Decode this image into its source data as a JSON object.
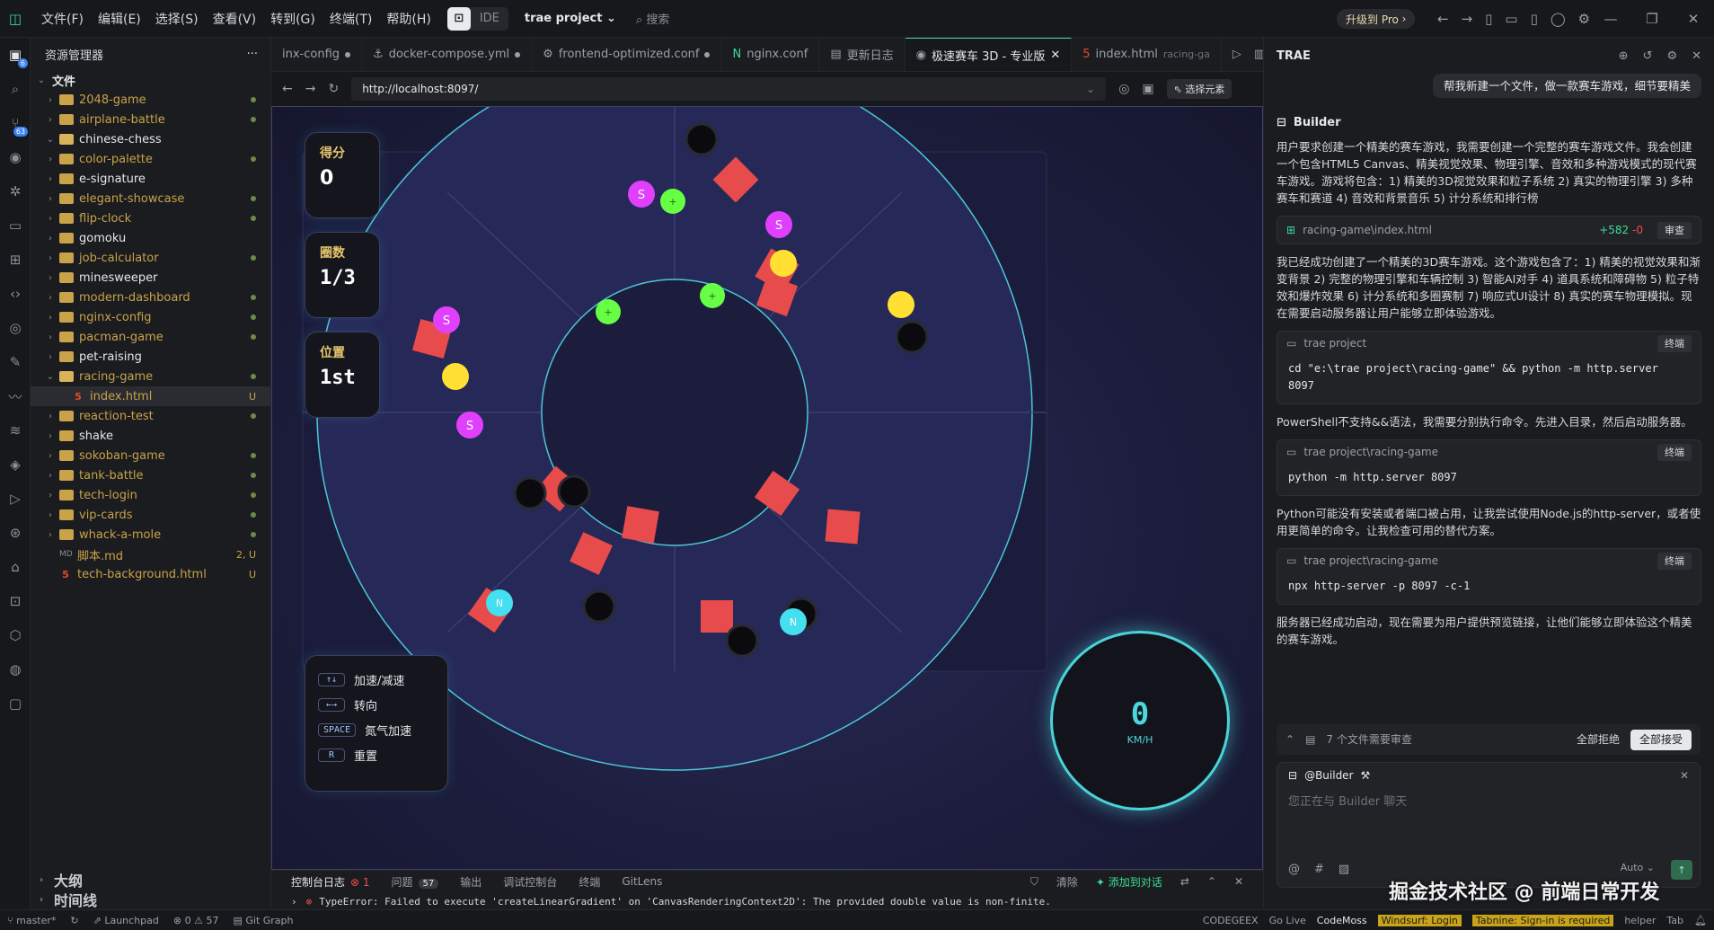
{
  "titlebar": {
    "menu": [
      "文件(F)",
      "编辑(E)",
      "选择(S)",
      "查看(V)",
      "转到(G)",
      "终端(T)",
      "帮助(H)"
    ],
    "ide_label": "IDE",
    "project": "trae project",
    "search": "搜索",
    "upgrade": "升级到 Pro"
  },
  "explorer": {
    "title": "资源管理器",
    "root": "文件",
    "items": [
      {
        "name": "2048-game",
        "type": "folder"
      },
      {
        "name": "airplane-battle",
        "type": "folder"
      },
      {
        "name": "chinese-chess",
        "type": "folder-open"
      },
      {
        "name": "color-palette",
        "type": "folder"
      },
      {
        "name": "e-signature",
        "type": "folder"
      },
      {
        "name": "elegant-showcase",
        "type": "folder"
      },
      {
        "name": "flip-clock",
        "type": "folder"
      },
      {
        "name": "gomoku",
        "type": "folder"
      },
      {
        "name": "job-calculator",
        "type": "folder"
      },
      {
        "name": "minesweeper",
        "type": "folder"
      },
      {
        "name": "modern-dashboard",
        "type": "folder"
      },
      {
        "name": "nginx-config",
        "type": "folder"
      },
      {
        "name": "pacman-game",
        "type": "folder"
      },
      {
        "name": "pet-raising",
        "type": "folder"
      },
      {
        "name": "racing-game",
        "type": "folder-open"
      },
      {
        "name": "index.html",
        "type": "html",
        "status": "U"
      },
      {
        "name": "reaction-test",
        "type": "folder"
      },
      {
        "name": "shake",
        "type": "folder"
      },
      {
        "name": "sokoban-game",
        "type": "folder"
      },
      {
        "name": "tank-battle",
        "type": "folder"
      },
      {
        "name": "tech-login",
        "type": "folder"
      },
      {
        "name": "vip-cards",
        "type": "folder"
      },
      {
        "name": "whack-a-mole",
        "type": "folder"
      },
      {
        "name": "脚本.md",
        "type": "md",
        "status": "2, U"
      },
      {
        "name": "tech-background.html",
        "type": "html",
        "status": "U"
      }
    ],
    "outline": "大纲",
    "timeline": "时间线"
  },
  "editor": {
    "tabs": [
      {
        "label": "inx-config",
        "icon": "",
        "active": false,
        "modified": true
      },
      {
        "label": "docker-compose.yml",
        "icon": "⚓",
        "active": false,
        "modified": true
      },
      {
        "label": "frontend-optimized.conf",
        "icon": "⚙",
        "active": false,
        "modified": true
      },
      {
        "label": "nginx.conf",
        "icon": "N",
        "active": false,
        "modified": false
      },
      {
        "label": "更新日志",
        "icon": "▤",
        "active": false,
        "modified": false
      },
      {
        "label": "极速赛车 3D - 专业版",
        "icon": "◉",
        "active": true,
        "modified": false
      },
      {
        "label": "index.html",
        "icon": "5",
        "active": false,
        "modified": false,
        "suffix": "racing-ga"
      }
    ],
    "url": "http://localhost:8097/",
    "pick_element": "选择元素"
  },
  "game": {
    "score_label": "得分",
    "score": "0",
    "lap_label": "圈数",
    "lap": "1/3",
    "pos_label": "位置",
    "pos": "1st",
    "controls": [
      {
        "key": "↑↓",
        "label": "加速/减速"
      },
      {
        "key": "←→",
        "label": "转向"
      },
      {
        "key": "SPACE",
        "label": "氮气加速"
      },
      {
        "key": "R",
        "label": "重置"
      }
    ],
    "speed": "0",
    "speed_unit": "KM/H"
  },
  "bottom": {
    "tabs": [
      {
        "label": "控制台日志",
        "err": "1"
      },
      {
        "label": "问题",
        "count": "57"
      },
      {
        "label": "输出"
      },
      {
        "label": "调试控制台"
      },
      {
        "label": "终端"
      },
      {
        "label": "GitLens"
      }
    ],
    "clear": "清除",
    "add_to_chat": "添加到对话",
    "error": "TypeError: Failed to execute 'createLinearGradient' on 'CanvasRenderingContext2D': The provided double value is non-finite."
  },
  "chat": {
    "title": "TRAE",
    "user_msg": "帮我新建一个文件，做一款赛车游戏，细节要精美",
    "builder": "Builder",
    "p1": "用户要求创建一个精美的赛车游戏，我需要创建一个完整的赛车游戏文件。我会创建一个包含HTML5 Canvas、精美视觉效果、物理引擎、音效和多种游戏模式的现代赛车游戏。游戏将包含：1) 精美的3D视觉效果和粒子系统 2) 真实的物理引擎 3) 多种赛车和赛道 4) 音效和背景音乐 5) 计分系统和排行榜",
    "file_card": {
      "path": "racing-game\\index.html",
      "add": "+582",
      "del": "-0",
      "btn": "审查"
    },
    "p2": "我已经成功创建了一个精美的3D赛车游戏。这个游戏包含了：1) 精美的视觉效果和渐变背景 2) 完整的物理引擎和车辆控制 3) 智能AI对手 4) 道具系统和障碍物 5) 粒子特效和爆炸效果 6) 计分系统和多圈赛制 7) 响应式UI设计 8) 真实的赛车物理模拟。现在需要启动服务器让用户能够立即体验游戏。",
    "term1": {
      "cwd": "trae project",
      "cmd": "cd \"e:\\trae project\\racing-game\" && python -m http.server 8097",
      "btn": "终端"
    },
    "p3": "PowerShell不支持&&语法，我需要分别执行命令。先进入目录，然后启动服务器。",
    "term2": {
      "cwd": "trae project\\racing-game",
      "cmd": "python -m http.server 8097",
      "btn": "终端"
    },
    "p4": "Python可能没有安装或者端口被占用，让我尝试使用Node.js的http-server，或者使用更简单的命令。让我检查可用的替代方案。",
    "term3": {
      "cwd": "trae project\\racing-game",
      "cmd": "npx http-server -p 8097 -c-1",
      "btn": "终端"
    },
    "p5": "服务器已经成功启动，现在需要为用户提供预览链接，让他们能够立即体验这个精美的赛车游戏。",
    "review": {
      "text": "7 个文件需要审查",
      "reject": "全部拒绝",
      "accept": "全部接受"
    },
    "input": {
      "agent": "@Builder",
      "placeholder": "您正在与 Builder 聊天",
      "mode": "Auto"
    }
  },
  "status": {
    "branch": "master*",
    "launchpad": "Launchpad",
    "problems": "0 ⚠ 57",
    "gitgraph": "Git Graph",
    "right": [
      "CODEGEEX",
      "Go Live",
      "CodeMoss",
      "Windsurf: Login",
      "Tabnine: Sign-in is required",
      "helper",
      "Tab"
    ]
  },
  "watermark": "掘金技术社区 @ 前端日常开发",
  "colors": {
    "accent": "#3ddc97",
    "track_edge": "#49d3d8",
    "nitro": "#e040fb",
    "coin": "#ffe033",
    "boost": "#66ff44",
    "obstacle": "#e84b4b",
    "shield": "#44e0f0"
  }
}
